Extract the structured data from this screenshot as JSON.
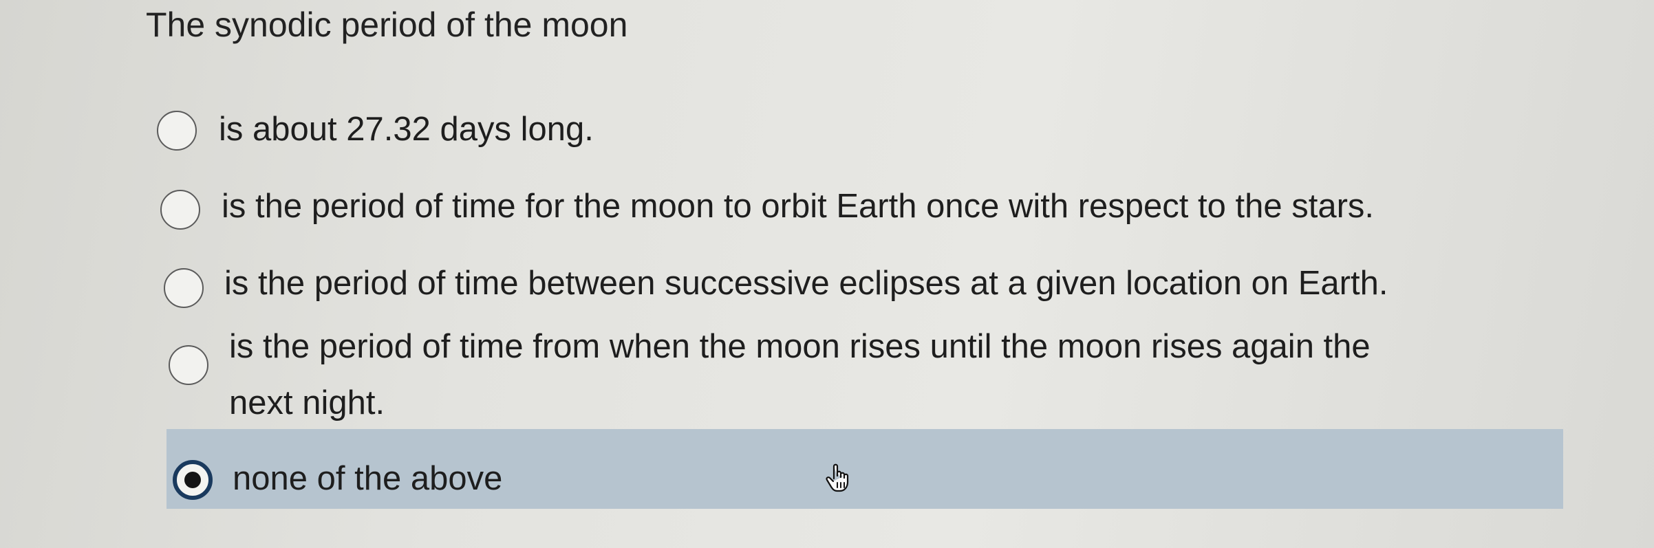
{
  "question": {
    "text": "The synodic period of the moon"
  },
  "options": [
    {
      "label": "is about 27.32 days long.",
      "selected": false
    },
    {
      "label": "is the period of time for the moon to orbit Earth once with respect to the stars.",
      "selected": false
    },
    {
      "label": "is the period of time between successive eclipses at a given location on Earth.",
      "selected": false
    },
    {
      "label_line1": "is the period of time from when the moon rises until the moon rises again the",
      "label_line2": "next night.",
      "selected": false
    },
    {
      "label": "none of the above",
      "selected": true
    }
  ],
  "colors": {
    "selected_band": "#b6c4cf",
    "selected_radio_border": "#1a3a5e",
    "background": "#e3e3df"
  },
  "icons": {
    "cursor": "hand-pointer-icon"
  }
}
